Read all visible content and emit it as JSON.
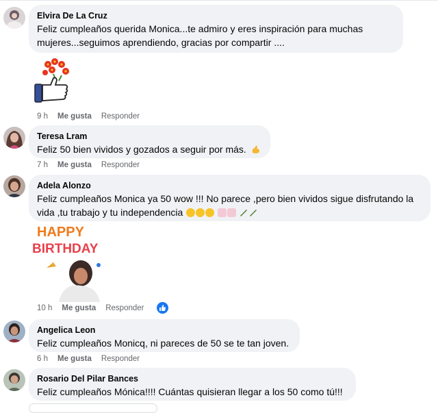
{
  "comments": [
    {
      "author": "Elvira De La Cruz",
      "text": "Feliz cumpleaños querida Monica...te admiro y eres inspiración para muchas mujeres...seguimos aprendiendo, gracias por compartir ....",
      "time": "9 h",
      "like_label": "Me gusta",
      "reply_label": "Responder"
    },
    {
      "author": "Teresa Lram",
      "text": "Feliz 50 bien vividos y gozados a seguir por más.",
      "time": "7 h",
      "like_label": "Me gusta",
      "reply_label": "Responder"
    },
    {
      "author": "Adela Alonzo",
      "text": "Feliz cumpleaños Monica ya 50 wow !!! No parece ,pero bien vividos sigue disfrutando la vida ,tu trabajo y tu independencia",
      "time": "10 h",
      "like_label": "Me gusta",
      "reply_label": "Responder",
      "sticker_text_1": "HAPPY",
      "sticker_text_2": "BIRTHDAY"
    },
    {
      "author": "Angelica Leon",
      "text": "Feliz cumpleaños Monicq, ni pareces de 50 se te tan joven.",
      "time": "6 h",
      "like_label": "Me gusta",
      "reply_label": "Responder"
    },
    {
      "author": "Rosario Del Pilar Bances",
      "text": "Feliz cumpleaños Mónica!!!! Cuántas quisieran llegar a los 50 como tú!!!",
      "time": "",
      "like_label": "",
      "reply_label": ""
    }
  ],
  "colors": {
    "bubble": "#f0f2f5",
    "secondary_text": "#65676b",
    "like_blue": "#1877f2"
  },
  "icons": [
    "thumbs-up-flowers-sticker",
    "flexed-biceps-emoji",
    "smiling-face-emoji",
    "cake-emoji",
    "bottle-emoji",
    "like-reaction-icon",
    "happy-birthday-sticker"
  ]
}
